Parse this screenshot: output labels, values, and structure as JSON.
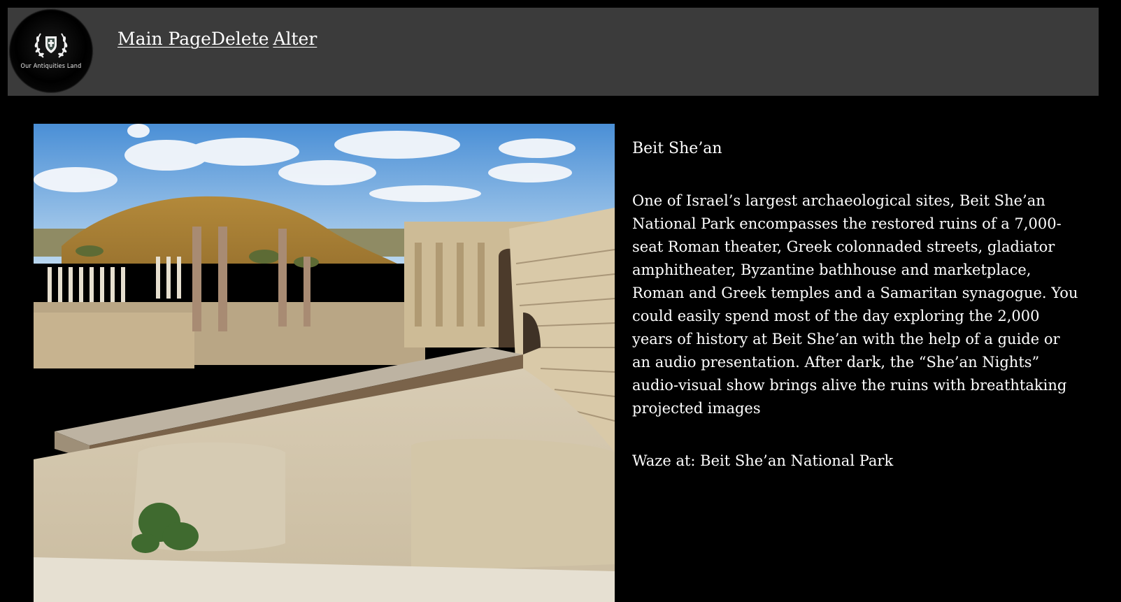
{
  "header": {
    "logo_text": "Our Antiquities Land",
    "nav": {
      "main_page": "Main Page",
      "delete": "Delete",
      "alter": "Alter"
    }
  },
  "site": {
    "title": "Beit She’an",
    "description": "One of Israel’s largest archaeological sites, Beit She’an National Park encompasses the restored ruins of a 7,000-seat Roman theater, Greek colonnaded streets, gladiator amphitheater, Byzantine bathhouse and marketplace, Roman and Greek temples and a Samaritan synagogue. You could easily spend most of the day exploring the 2,000 years of history at Beit She’an with the help of a guide or an audio presentation. After dark, the “She’an Nights” audio-visual show brings alive the ruins with breathtaking projected images",
    "waze": "Waze at: Beit She’an National Park"
  },
  "colors": {
    "page_background": "#000000",
    "navbar_background": "#3b3b3b",
    "text": "#ffffff"
  }
}
